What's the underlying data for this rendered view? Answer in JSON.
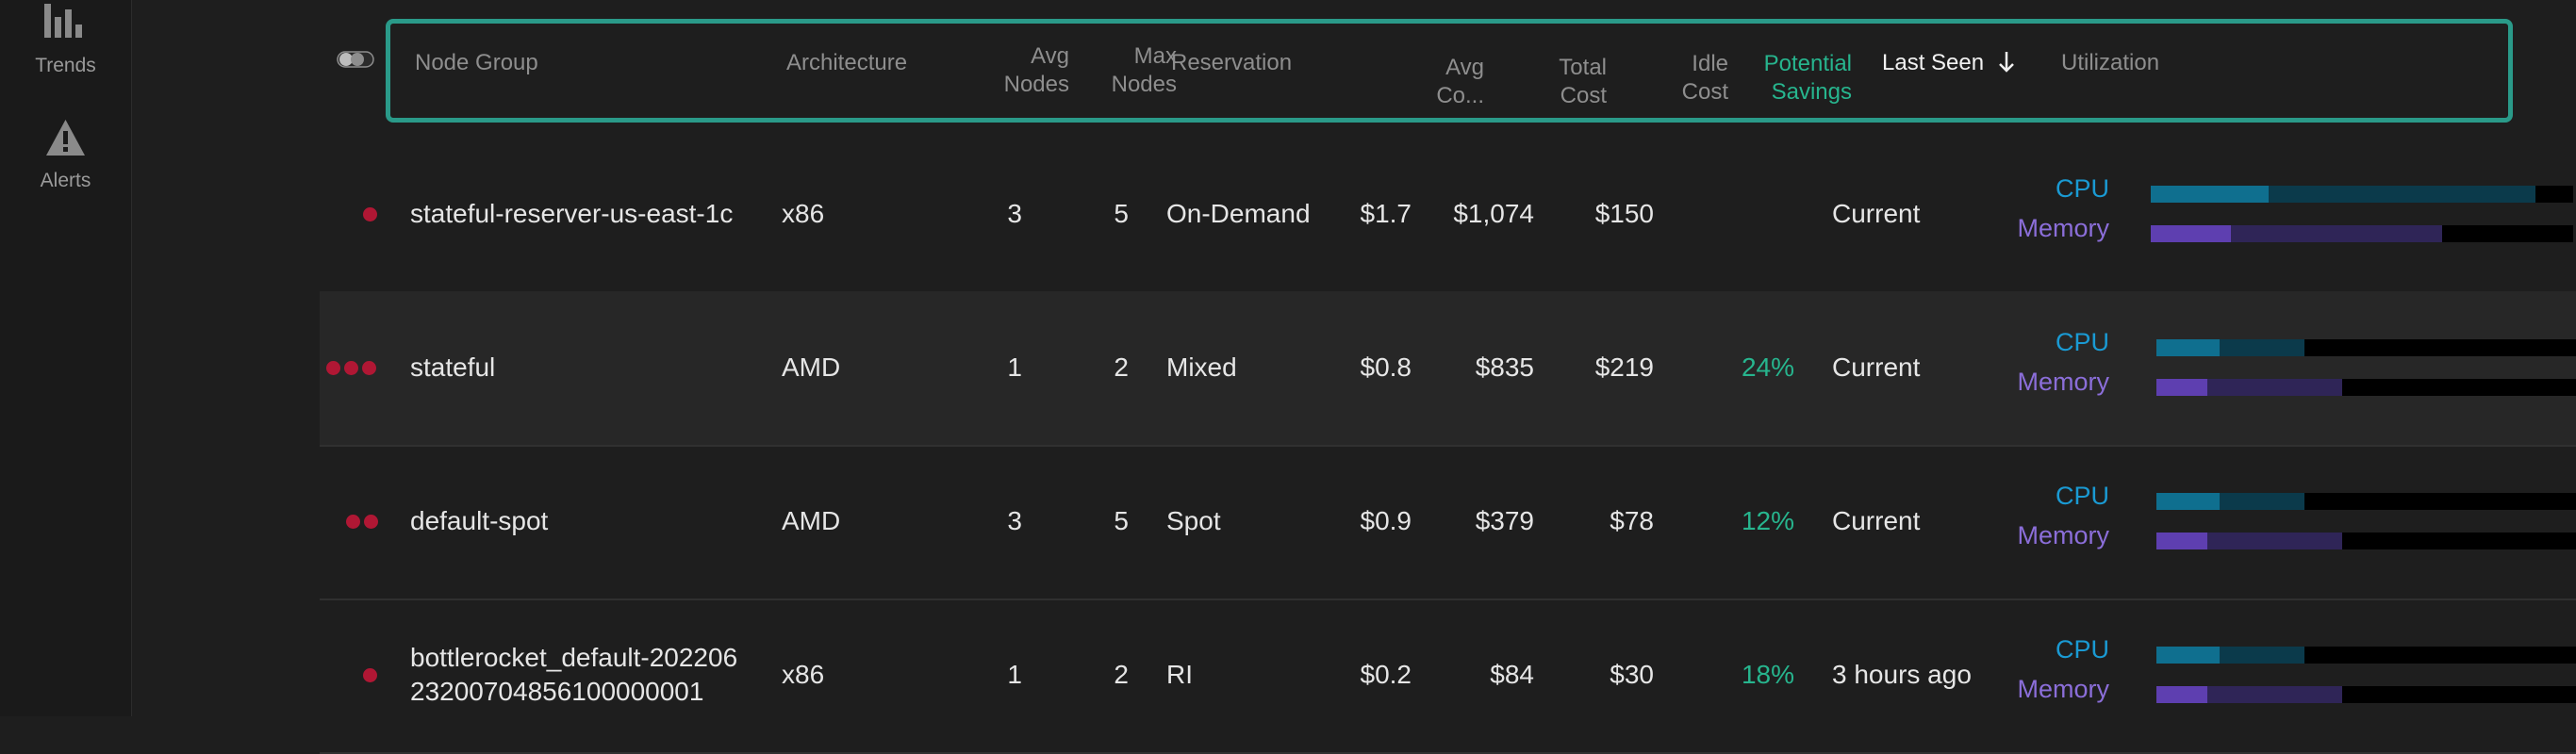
{
  "sidebar": {
    "items": [
      {
        "label": "Trends",
        "icon": "bar-chart-icon"
      },
      {
        "label": "Alerts",
        "icon": "warning-icon"
      }
    ]
  },
  "table": {
    "columns": {
      "node_group": "Node Group",
      "architecture": "Architecture",
      "avg_nodes_1": "Avg",
      "avg_nodes_2": "Nodes",
      "max_nodes_1": "Max",
      "max_nodes_2": "Nodes",
      "reservation": "Reservation",
      "avg_co_1": "Avg",
      "avg_co_2": "Co...",
      "total_cost_1": "Total",
      "total_cost_2": "Cost",
      "idle_cost_1": "Idle",
      "idle_cost_2": "Cost",
      "savings_1": "Potential",
      "savings_2": "Savings",
      "last_seen": "Last Seen",
      "utilization": "Utilization"
    },
    "sort_icon": "arrow-down-icon",
    "colors": {
      "accent": "#2a9a89",
      "savings": "#27b58e",
      "cpu": "#1a9ad3",
      "memory": "#8b6ed9",
      "status_dot": "#b01734"
    },
    "rows": [
      {
        "dots": 1,
        "name_1": "stateful-reserver-us-east-1c",
        "name_2": "",
        "architecture": "x86",
        "avg_nodes": "3",
        "max_nodes": "5",
        "reservation": "On-Demand",
        "avg_co": "$1.7",
        "total_cost": "$1,074",
        "idle_cost": "$150",
        "savings": "",
        "last_seen": "Current",
        "cpu_label": "CPU",
        "mem_label": "Memory",
        "cpu_used": 0.28,
        "cpu_requested": 0.91,
        "mem_used": 0.19,
        "mem_requested": 0.69
      },
      {
        "dots": 3,
        "name_1": "stateful",
        "name_2": "",
        "architecture": "AMD",
        "avg_nodes": "1",
        "max_nodes": "2",
        "reservation": "Mixed",
        "avg_co": "$0.8",
        "total_cost": "$835",
        "idle_cost": "$219",
        "savings": "24%",
        "last_seen": "Current",
        "cpu_label": "CPU",
        "mem_label": "Memory",
        "cpu_used": 0.15,
        "cpu_requested": 0.35,
        "mem_used": 0.12,
        "mem_requested": 0.44
      },
      {
        "dots": 2,
        "name_1": "default-spot",
        "name_2": "",
        "architecture": "AMD",
        "avg_nodes": "3",
        "max_nodes": "5",
        "reservation": "Spot",
        "avg_co": "$0.9",
        "total_cost": "$379",
        "idle_cost": "$78",
        "savings": "12%",
        "last_seen": "Current",
        "cpu_label": "CPU",
        "mem_label": "Memory",
        "cpu_used": 0.15,
        "cpu_requested": 0.35,
        "mem_used": 0.12,
        "mem_requested": 0.44
      },
      {
        "dots": 1,
        "name_1": "bottlerocket_default-202206",
        "name_2": "23200704856100000001",
        "architecture": "x86",
        "avg_nodes": "1",
        "max_nodes": "2",
        "reservation": "RI",
        "avg_co": "$0.2",
        "total_cost": "$84",
        "idle_cost": "$30",
        "savings": "18%",
        "last_seen": "3 hours ago",
        "cpu_label": "CPU",
        "mem_label": "Memory",
        "cpu_used": 0.15,
        "cpu_requested": 0.35,
        "mem_used": 0.12,
        "mem_requested": 0.44
      }
    ]
  }
}
